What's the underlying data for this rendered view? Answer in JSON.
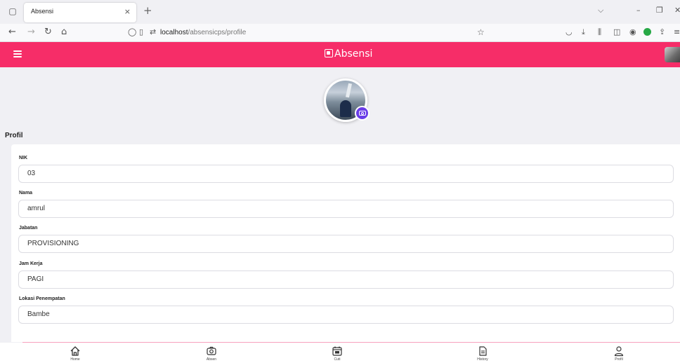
{
  "browser": {
    "tab_title": "Absensi",
    "tab_close": "×",
    "new_tab": "+",
    "url_host": "localhost",
    "url_path": "/absensicps/profile"
  },
  "header": {
    "brand": "Absensi"
  },
  "profile": {
    "section_title": "Profil"
  },
  "fields": [
    {
      "label": "NIK",
      "value": "03"
    },
    {
      "label": "Nama",
      "value": "amrul"
    },
    {
      "label": "Jabatan",
      "value": "PROVISIONING"
    },
    {
      "label": "Jam Kerja",
      "value": "PAGI"
    },
    {
      "label": "Lokasi Penempatan",
      "value": "Bambe"
    }
  ],
  "bottom_nav": [
    {
      "label": "Home",
      "icon": "home-icon"
    },
    {
      "label": "Absen",
      "icon": "camera-icon"
    },
    {
      "label": "Cuti",
      "icon": "calendar-icon"
    },
    {
      "label": "History",
      "icon": "document-icon"
    },
    {
      "label": "Profil",
      "icon": "user-icon"
    }
  ],
  "colors": {
    "accent": "#f62d68",
    "camera_button": "#6a3de8"
  }
}
